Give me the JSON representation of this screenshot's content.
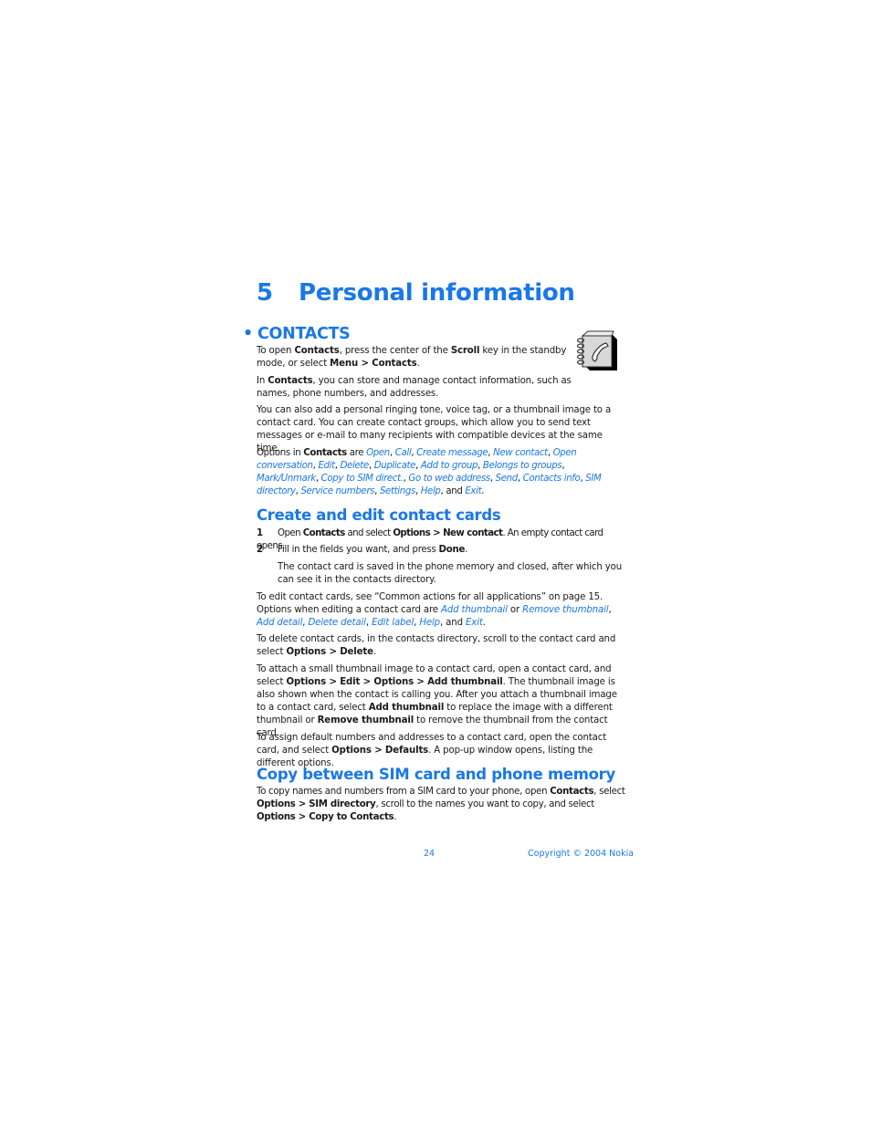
{
  "chapter": {
    "number": "5",
    "title": "Personal information"
  },
  "sections": {
    "contacts": {
      "bullet": "•",
      "heading": "CONTACTS",
      "icon": "contacts-book-phone-icon",
      "p1": [
        "To open ",
        "Contacts",
        ", press the center of the ",
        "Scroll",
        " key in the standby mode, or select ",
        "Menu > Contacts",
        "."
      ],
      "p2": [
        "In ",
        "Contacts",
        ", you can store and manage contact information, such as names, phone numbers, and addresses."
      ],
      "p3": "You can also add a personal ringing tone, voice tag, or a thumbnail image to a contact card. You can create contact groups, which allow you to send text messages or e-mail to many recipients with compatible devices at the same time.",
      "options_intro": "Options in ",
      "options_app": "Contacts",
      "options_are": " are ",
      "options": [
        "Open",
        "Call",
        "Create message",
        "New contact",
        "Open conversation",
        "Edit",
        "Delete",
        "Duplicate",
        "Add to group",
        "Belongs to groups",
        "Mark/Unmark",
        "Copy to SIM direct.",
        "Go to web address",
        "Send",
        "Contacts info",
        "SIM directory",
        "Service numbers",
        "Settings",
        "Help",
        "Exit"
      ]
    },
    "create": {
      "heading": "Create and edit contact cards",
      "steps": [
        {
          "n": "1",
          "parts": [
            "Open ",
            "Contacts",
            " and select ",
            "Options > New contact",
            ". An empty contact card opens."
          ]
        },
        {
          "n": "2",
          "parts": [
            "Fill in the fields you want, and press ",
            "Done",
            "."
          ]
        }
      ],
      "step_note": "The contact card is saved in the phone memory and closed, after which you can see it in the contacts directory.",
      "edit_p": "To edit contact cards, see “Common actions for all applications” on page 15. Options when editing a contact card are ",
      "edit_options": [
        "Add thumbnail",
        "Remove thumbnail",
        "Add detail",
        "Delete detail",
        "Edit label",
        "Help",
        "Exit"
      ],
      "delete_p": [
        "To delete contact cards, in the contacts directory, scroll to the contact card and select ",
        "Options > Delete",
        "."
      ],
      "thumb_p": [
        "To attach a small thumbnail image to a contact card, open a contact card, and select ",
        "Options > Edit > Options > Add thumbnail",
        ". The thumbnail image is also shown when the contact is calling you. After you attach a thumbnail image to a contact card, select ",
        "Add thumbnail",
        " to replace the image with a different thumbnail or ",
        "Remove thumbnail",
        " to remove the thumbnail from the contact card."
      ],
      "defaults_p": [
        "To assign default numbers and addresses to a contact card, open the contact card, and select ",
        "Options > Defaults",
        ". A pop-up window opens, listing the different options."
      ]
    },
    "copy": {
      "heading": "Copy between SIM card and phone memory",
      "p": [
        "To copy names and numbers from a SIM card to your phone, open ",
        "Contacts",
        ", select ",
        "Options > SIM directory",
        ", scroll to the names you want to copy, and select ",
        "Options > Copy to Contacts",
        "."
      ]
    }
  },
  "footer": {
    "page": "24",
    "copyright": "Copyright © 2004 Nokia"
  }
}
